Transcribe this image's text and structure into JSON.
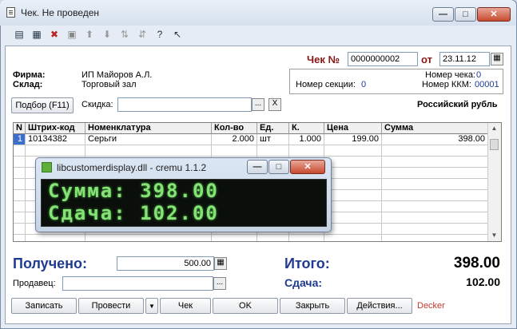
{
  "window": {
    "title": "Чек. Не проведен"
  },
  "check": {
    "number_label": "Чек №",
    "number_value": "0000000002",
    "date_label": "от",
    "date_value": "23.11.12"
  },
  "firm": {
    "label": "Фирма:",
    "value": "ИП Майоров А.Л."
  },
  "warehouse": {
    "label": "Склад:",
    "value": "Торговый зал"
  },
  "info": {
    "receipt_number_label": "Номер чека:",
    "receipt_number_value": "0",
    "section_label": "Номер секции:",
    "section_value": "0",
    "kkm_label": "Номер ККМ:",
    "kkm_value": "00001"
  },
  "selection": {
    "button": "Подбор (F11)",
    "discount_label": "Скидка:",
    "browse": "...",
    "clear": "X"
  },
  "currency": "Российский рубль",
  "table": {
    "columns": [
      "N",
      "Штрих-код",
      "Номенклатура",
      "Кол-во",
      "Ед.",
      "К.",
      "Цена",
      "Сумма"
    ],
    "rows": [
      [
        "1",
        "10134382",
        "Серьги",
        "2.000",
        "шт",
        "1.000",
        "199.00",
        "398.00"
      ]
    ]
  },
  "popup": {
    "title": "libcustomerdisplay.dll - cremu 1.1.2",
    "line1": "Сумма: 398.00",
    "line2": "Сдача: 102.00"
  },
  "totals": {
    "received_label": "Получено:",
    "received_value": "500.00",
    "total_label": "Итого:",
    "total_value": "398.00",
    "seller_label": "Продавец:",
    "change_label": "Сдача:",
    "change_value": "102.00"
  },
  "buttons": {
    "write": "Записать",
    "post": "Провести",
    "check": "Чек",
    "ok": "OK",
    "close": "Закрыть",
    "actions": "Действия..."
  },
  "user": "Decker",
  "colors": {
    "accent_blue": "#1f3b8f",
    "dark_red": "#8b1414",
    "status_red": "#c0392b",
    "lcd_green": "#86e276"
  }
}
